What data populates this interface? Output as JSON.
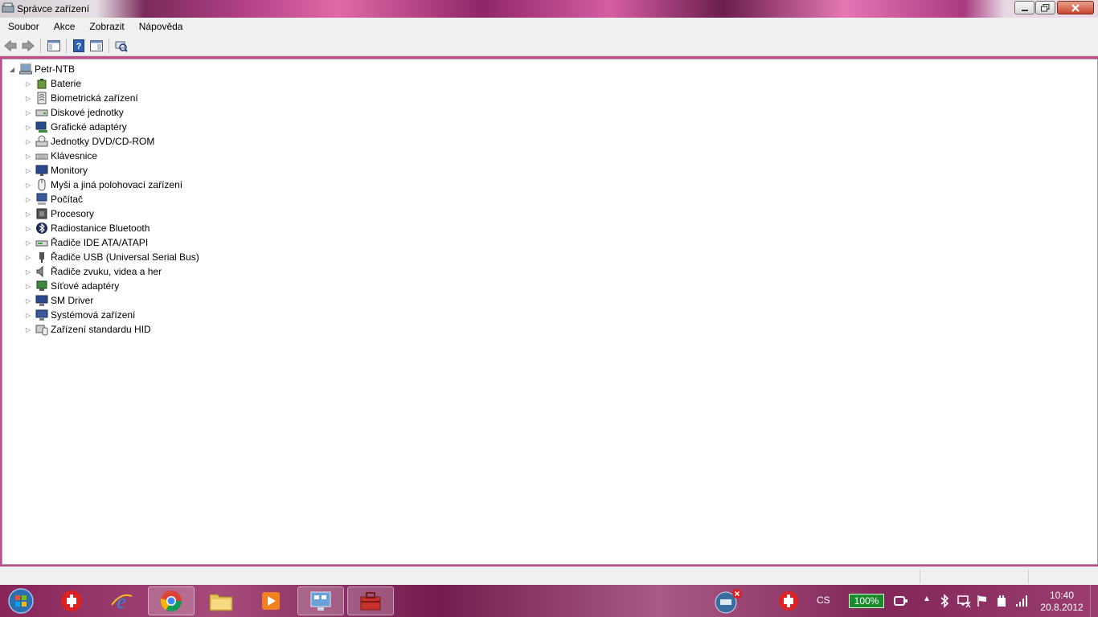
{
  "window": {
    "title": "Správce zařízení"
  },
  "menu": [
    "Soubor",
    "Akce",
    "Zobrazit",
    "Nápověda"
  ],
  "toolbar": {
    "icons": [
      "back-arrow-icon",
      "forward-arrow-icon",
      "show-hide-console-tree-icon",
      "help-icon",
      "properties-pane-icon",
      "scan-hardware-icon"
    ]
  },
  "tree": {
    "root": "Petr-NTB",
    "items": [
      {
        "label": "Baterie",
        "icon": "battery-icon"
      },
      {
        "label": "Biometrická zařízení",
        "icon": "biometric-icon"
      },
      {
        "label": "Diskové jednotky",
        "icon": "disk-drive-icon"
      },
      {
        "label": "Grafické adaptéry",
        "icon": "display-adapter-icon"
      },
      {
        "label": "Jednotky DVD/CD-ROM",
        "icon": "dvd-drive-icon"
      },
      {
        "label": "Klávesnice",
        "icon": "keyboard-icon"
      },
      {
        "label": "Monitory",
        "icon": "monitor-icon"
      },
      {
        "label": "Myši a jiná polohovací zařízení",
        "icon": "mouse-icon"
      },
      {
        "label": "Počítač",
        "icon": "computer-icon"
      },
      {
        "label": "Procesory",
        "icon": "processor-icon"
      },
      {
        "label": "Radiostanice Bluetooth",
        "icon": "bluetooth-icon"
      },
      {
        "label": "Řadiče IDE ATA/ATAPI",
        "icon": "ide-controller-icon"
      },
      {
        "label": "Řadiče USB (Universal Serial Bus)",
        "icon": "usb-controller-icon"
      },
      {
        "label": "Řadiče zvuku, videa a her",
        "icon": "sound-icon"
      },
      {
        "label": "Síťové adaptéry",
        "icon": "network-adapter-icon"
      },
      {
        "label": "SM Driver",
        "icon": "sm-driver-icon"
      },
      {
        "label": "Systémová zařízení",
        "icon": "system-device-icon"
      },
      {
        "label": "Zařízení standardu HID",
        "icon": "hid-device-icon"
      }
    ]
  },
  "taskbar": {
    "language": "CS",
    "battery": "100%",
    "time": "10:40",
    "date": "20.8.2012"
  }
}
